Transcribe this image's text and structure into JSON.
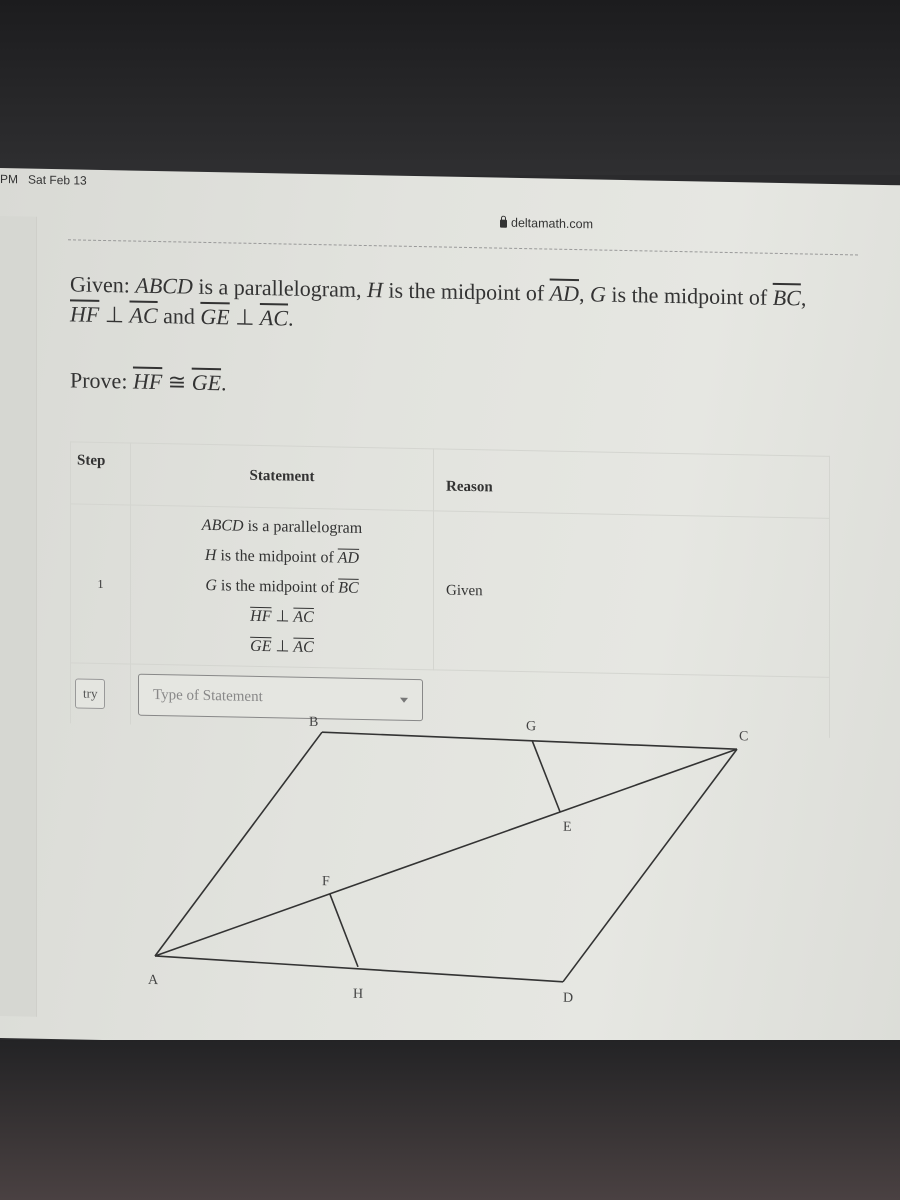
{
  "device": {
    "status_time": "PM",
    "status_date": "Sat Feb 13"
  },
  "browser": {
    "url": "deltamath.com",
    "lock_icon": "lock-icon"
  },
  "problem": {
    "given_label": "Given:",
    "given_parts": {
      "abcd": "ABCD",
      "t1": " is a parallelogram, ",
      "h": "H",
      "t2": " is the midpoint of ",
      "ad": "AD",
      "t3": ", ",
      "g": "G",
      "t4": " is the midpoint of ",
      "bc": "BC",
      "t5": ", ",
      "hf": "HF",
      "perp1": " ⊥ ",
      "ac1": "AC",
      "t6": " and ",
      "ge": "GE",
      "perp2": " ⊥ ",
      "ac2": "AC",
      "t7": "."
    },
    "prove_label": "Prove:",
    "prove_parts": {
      "hf": "HF",
      "cong": " ≅ ",
      "ge": "GE",
      "end": "."
    }
  },
  "proof_table": {
    "headers": {
      "step": "Step",
      "statement": "Statement",
      "reason": "Reason"
    },
    "rows": [
      {
        "step": "1",
        "statements": [
          {
            "a": "ABCD",
            "b": " is a parallelogram",
            "c": ""
          },
          {
            "a": "H",
            "b": " is the midpoint of ",
            "c": "AD"
          },
          {
            "a": "G",
            "b": " is the midpoint of ",
            "c": "BC"
          },
          {
            "a": "HF",
            "b": " ⊥ ",
            "c": "AC"
          },
          {
            "a": "GE",
            "b": " ⊥ ",
            "c": "AC"
          }
        ],
        "reason": "Given"
      }
    ],
    "try_label": "try",
    "statement_select_placeholder": "Type of Statement"
  },
  "diagram": {
    "points": {
      "A": "A",
      "B": "B",
      "C": "C",
      "D": "D",
      "E": "E",
      "F": "F",
      "G": "G",
      "H": "H"
    }
  }
}
